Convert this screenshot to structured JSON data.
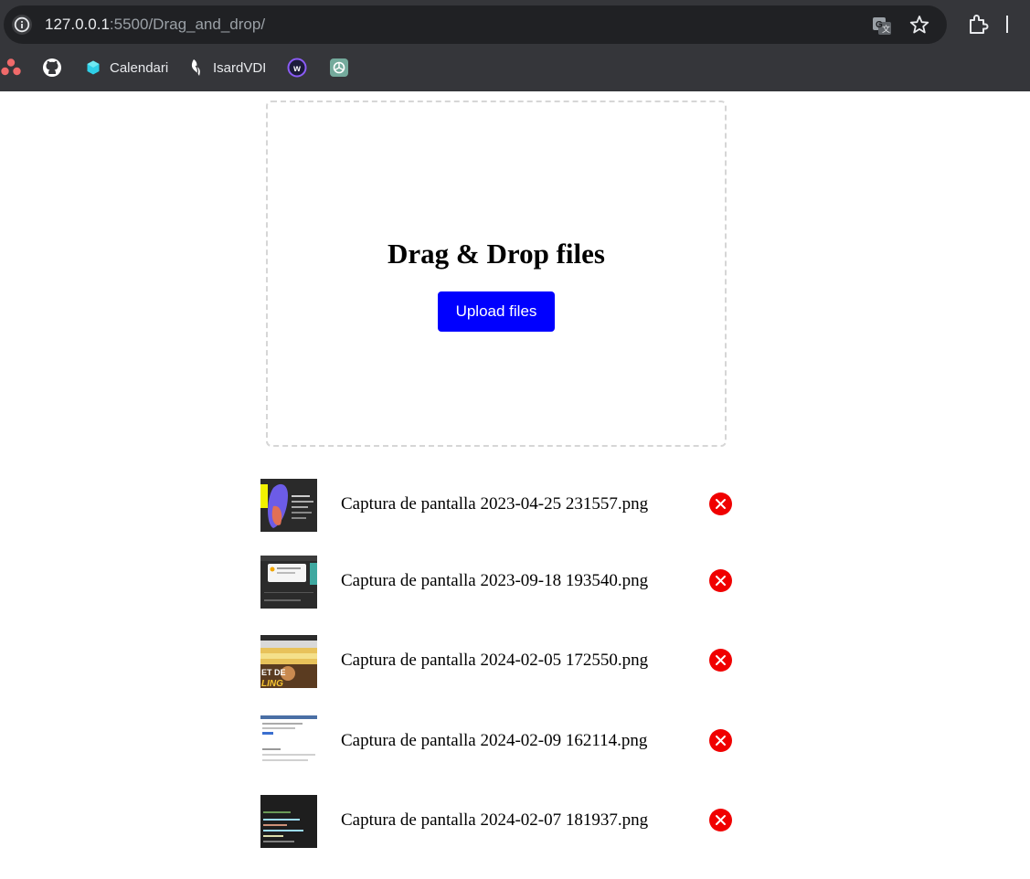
{
  "browser": {
    "url_host": "127.0.0.1",
    "url_path": ":5500/Drag_and_drop/",
    "bookmarks": [
      {
        "label": "",
        "icon": "asana-icon"
      },
      {
        "label": "",
        "icon": "github-icon"
      },
      {
        "label": "Calendari",
        "icon": "calendar-hex-icon"
      },
      {
        "label": "IsardVDI",
        "icon": "isardvdi-icon"
      },
      {
        "label": "",
        "icon": "w-logo-icon"
      },
      {
        "label": "",
        "icon": "chatgpt-icon"
      }
    ]
  },
  "dropzone": {
    "title": "Drag & Drop files",
    "upload_label": "Upload files"
  },
  "files": [
    {
      "name": "Captura de pantalla 2023-04-25 231557.png"
    },
    {
      "name": "Captura de pantalla 2023-09-18 193540.png"
    },
    {
      "name": "Captura de pantalla 2024-02-05 172550.png"
    },
    {
      "name": "Captura de pantalla 2024-02-09 162114.png"
    },
    {
      "name": "Captura de pantalla 2024-02-07 181937.png"
    }
  ],
  "colors": {
    "upload_button": "#0000ff",
    "remove_button": "#f00000",
    "dropzone_border": "#d6d6d6"
  }
}
